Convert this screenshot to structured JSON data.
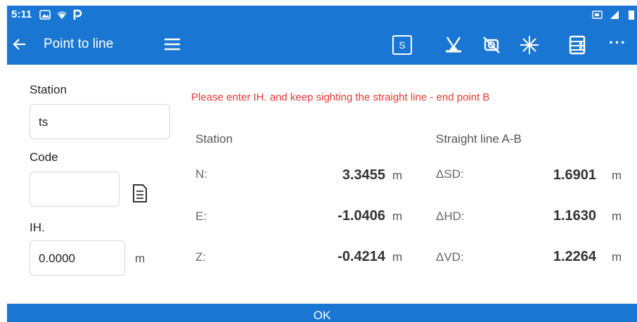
{
  "status_bar": {
    "time": "5:11",
    "icons": [
      "gallery-icon",
      "wifi-icon",
      "p-app-icon",
      "sim-icon",
      "signal-icon",
      "battery-icon"
    ]
  },
  "toolbar": {
    "title": "Point to line",
    "s_label": "S",
    "icons": [
      "back-arrow-icon",
      "hamburger-menu-icon",
      "s-mode-icon",
      "prism-target-icon",
      "laser-off-icon",
      "star-burst-icon",
      "data-list-icon",
      "more-icon"
    ],
    "more_label": "···",
    "accent": "#1976d2"
  },
  "form": {
    "station_label": "Station",
    "station_value": "ts",
    "code_label": "Code",
    "code_value": "",
    "ih_label": "IH.",
    "ih_value": "0.0000",
    "ih_unit": "m"
  },
  "message": {
    "text": "Please enter IH. and keep sighting the straight line - end point B",
    "color": "#e53935"
  },
  "station_table": {
    "header": "Station",
    "rows": [
      {
        "label": "N:",
        "value": "3.3455",
        "unit": "m"
      },
      {
        "label": "E:",
        "value": "-1.0406",
        "unit": "m"
      },
      {
        "label": "Z:",
        "value": "-0.4214",
        "unit": "m"
      }
    ]
  },
  "line_table": {
    "header": "Straight line A-B",
    "rows": [
      {
        "label": "ΔSD:",
        "value": "1.6901",
        "unit": "m"
      },
      {
        "label": "ΔHD:",
        "value": "1.1630",
        "unit": "m"
      },
      {
        "label": "ΔVD:",
        "value": "1.2264",
        "unit": "m"
      }
    ]
  },
  "ok_button": {
    "label": "OK"
  }
}
